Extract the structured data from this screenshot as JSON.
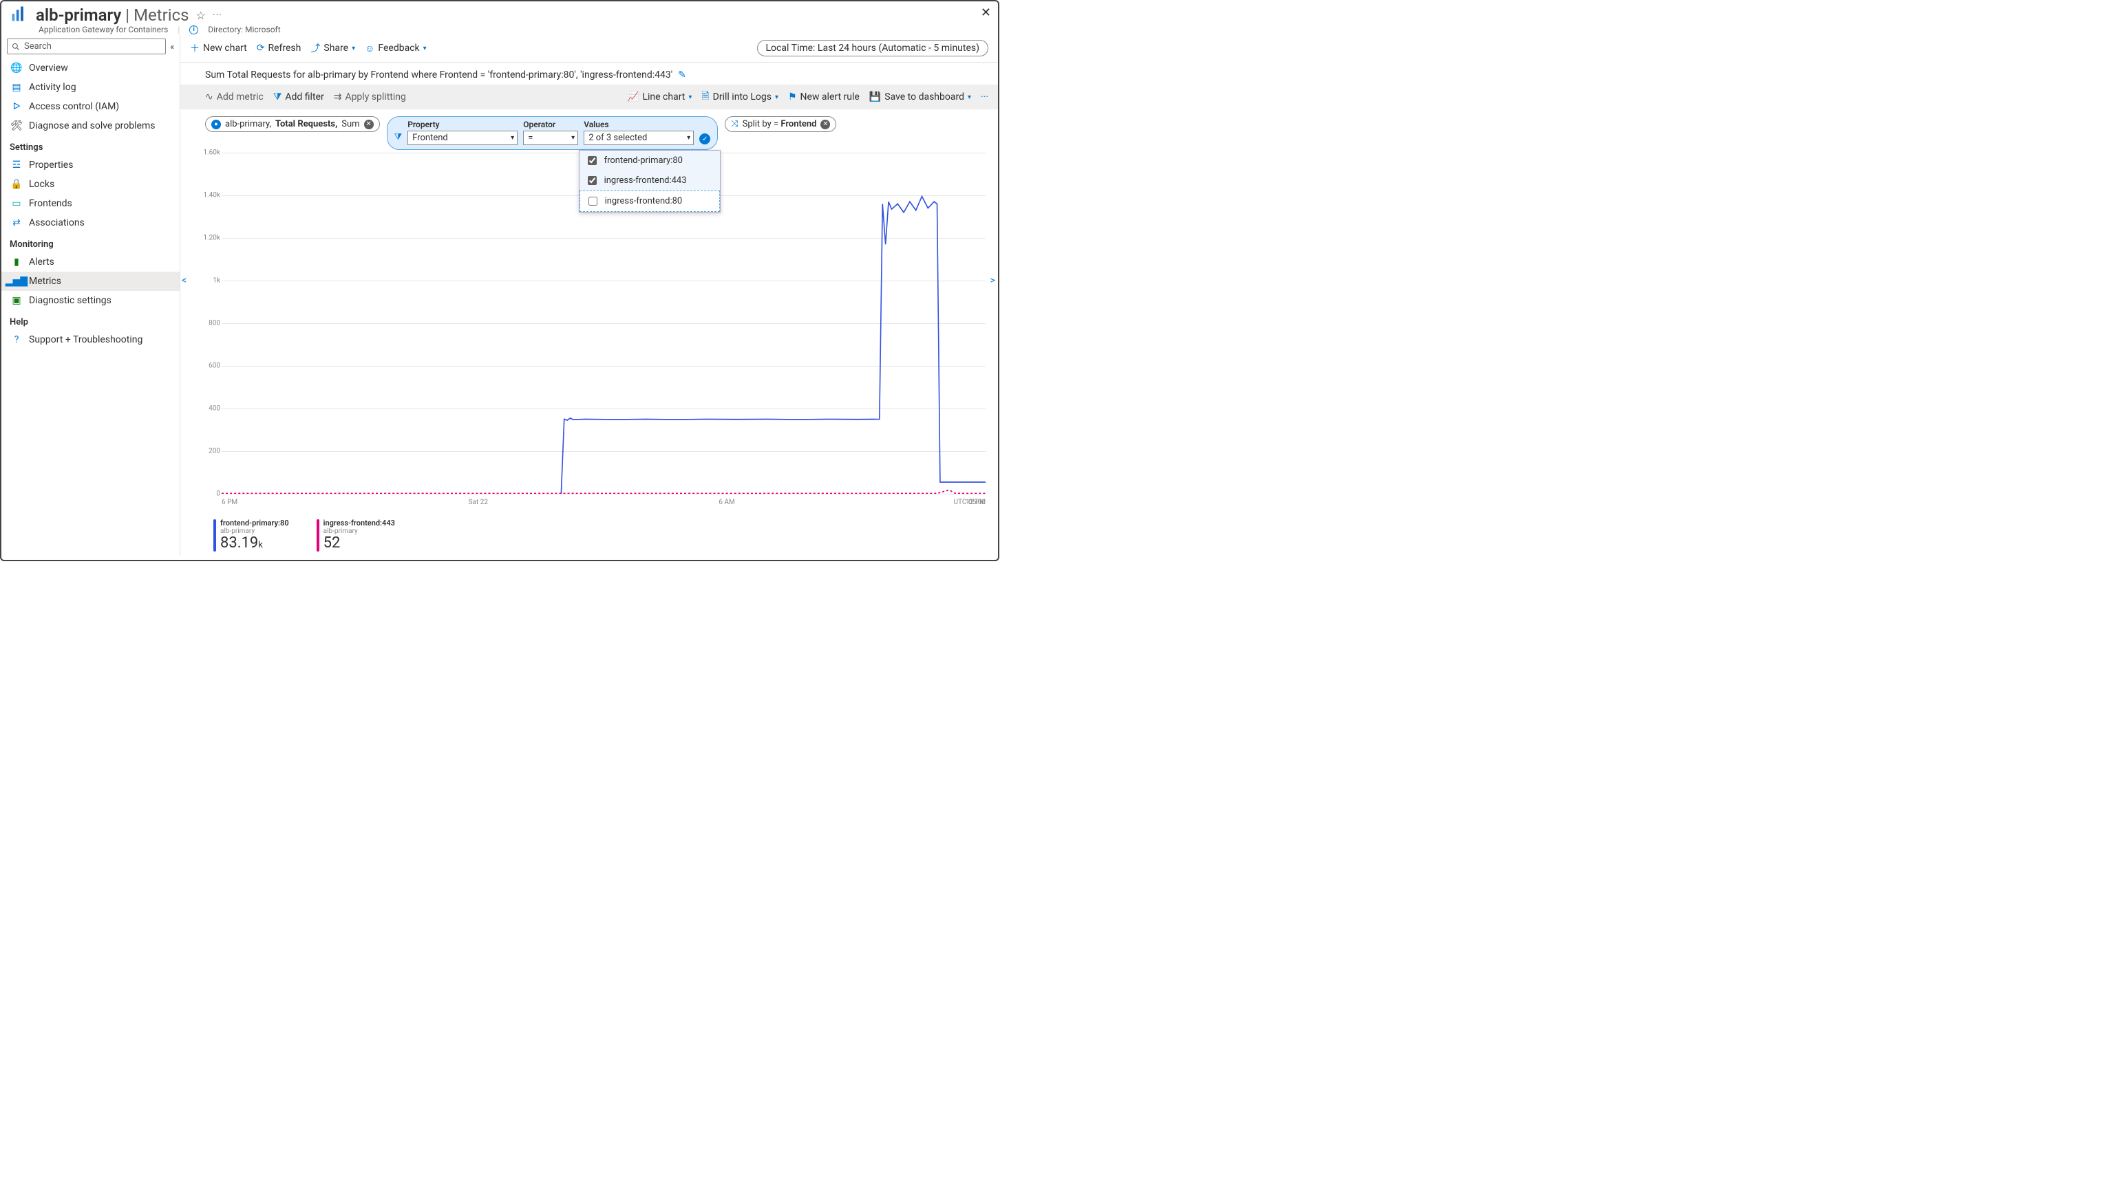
{
  "header": {
    "title_resource": "alb-primary",
    "title_page": "Metrics",
    "subtitle": "Application Gateway for Containers",
    "directory_label": "Directory: Microsoft"
  },
  "search_placeholder": "Search",
  "sidebar": {
    "items_top": [
      {
        "label": "Overview",
        "icon": "globe-icon"
      },
      {
        "label": "Activity log",
        "icon": "log-icon"
      },
      {
        "label": "Access control (IAM)",
        "icon": "people-icon"
      },
      {
        "label": "Diagnose and solve problems",
        "icon": "wrench-icon"
      }
    ],
    "section_settings": "Settings",
    "items_settings": [
      {
        "label": "Properties",
        "icon": "sliders-icon"
      },
      {
        "label": "Locks",
        "icon": "lock-icon"
      },
      {
        "label": "Frontends",
        "icon": "frontends-icon"
      },
      {
        "label": "Associations",
        "icon": "assoc-icon"
      }
    ],
    "section_monitoring": "Monitoring",
    "items_monitoring": [
      {
        "label": "Alerts",
        "icon": "alerts-icon"
      },
      {
        "label": "Metrics",
        "icon": "metrics-icon",
        "active": true
      },
      {
        "label": "Diagnostic settings",
        "icon": "diag-icon"
      }
    ],
    "section_help": "Help",
    "items_help": [
      {
        "label": "Support + Troubleshooting",
        "icon": "support-icon"
      }
    ]
  },
  "toolbar": {
    "new_chart": "New chart",
    "refresh": "Refresh",
    "share": "Share",
    "feedback": "Feedback",
    "time_range": "Local Time: Last 24 hours (Automatic - 5 minutes)"
  },
  "chart_header": "Sum Total Requests for alb-primary by Frontend where Frontend = 'frontend-primary:80', 'ingress-frontend:443'",
  "metricbar": {
    "add_metric": "Add metric",
    "add_filter": "Add filter",
    "apply_splitting": "Apply splitting",
    "line_chart": "Line chart",
    "drill_logs": "Drill into Logs",
    "new_alert": "New alert rule",
    "save_dash": "Save to dashboard"
  },
  "scope_pill": {
    "resource": "alb-primary,",
    "metric": "Total Requests,",
    "agg": "Sum"
  },
  "filter": {
    "property_label": "Property",
    "property_value": "Frontend",
    "operator_label": "Operator",
    "operator_value": "=",
    "values_label": "Values",
    "values_display": "2 of 3 selected",
    "options": [
      {
        "label": "frontend-primary:80",
        "checked": true
      },
      {
        "label": "ingress-frontend:443",
        "checked": true
      },
      {
        "label": "ingress-frontend:80",
        "checked": false
      }
    ]
  },
  "split_pill": {
    "prefix": "Split by = ",
    "value": "Frontend"
  },
  "utc_label": "UTC-05:00",
  "legend": [
    {
      "name": "frontend-primary:80",
      "sub": "alb-primary",
      "value": "83.19",
      "unit": "k",
      "color": "#3352e1"
    },
    {
      "name": "ingress-frontend:443",
      "sub": "alb-primary",
      "value": "52",
      "unit": "",
      "color": "#e3007b"
    }
  ],
  "chart_data": {
    "type": "line",
    "xlabel": "",
    "ylabel": "",
    "ylim": [
      0,
      1600
    ],
    "y_ticks": [
      "0",
      "200",
      "400",
      "600",
      "800",
      "1k",
      "1.20k",
      "1.40k",
      "1.60k"
    ],
    "x_ticks": [
      "6 PM",
      "Sat 22",
      "6 AM",
      "12 PM"
    ],
    "x_range_minutes": 1440,
    "series": [
      {
        "name": "frontend-primary:80",
        "color": "#3352e1",
        "points": [
          [
            560,
            0
          ],
          [
            565,
            350
          ],
          [
            570,
            345
          ],
          [
            575,
            355
          ],
          [
            580,
            348
          ],
          [
            600,
            350
          ],
          [
            650,
            348
          ],
          [
            700,
            350
          ],
          [
            750,
            348
          ],
          [
            800,
            350
          ],
          [
            850,
            349
          ],
          [
            900,
            350
          ],
          [
            950,
            348
          ],
          [
            1000,
            350
          ],
          [
            1050,
            349
          ],
          [
            1085,
            350
          ],
          [
            1090,
            1360
          ],
          [
            1095,
            1170
          ],
          [
            1100,
            1370
          ],
          [
            1105,
            1335
          ],
          [
            1115,
            1360
          ],
          [
            1125,
            1320
          ],
          [
            1135,
            1370
          ],
          [
            1145,
            1330
          ],
          [
            1155,
            1395
          ],
          [
            1165,
            1340
          ],
          [
            1175,
            1370
          ],
          [
            1180,
            1360
          ],
          [
            1185,
            55
          ],
          [
            1200,
            55
          ],
          [
            1230,
            55
          ],
          [
            1260,
            55
          ]
        ]
      },
      {
        "name": "ingress-frontend:443",
        "color": "#e3007b",
        "dashed": true,
        "points": [
          [
            0,
            2
          ],
          [
            100,
            2
          ],
          [
            200,
            2
          ],
          [
            300,
            2
          ],
          [
            400,
            2
          ],
          [
            500,
            2
          ],
          [
            600,
            2
          ],
          [
            700,
            2
          ],
          [
            800,
            2
          ],
          [
            900,
            2
          ],
          [
            1000,
            2
          ],
          [
            1100,
            2
          ],
          [
            1180,
            2
          ],
          [
            1200,
            18
          ],
          [
            1210,
            2
          ],
          [
            1260,
            2
          ]
        ]
      }
    ]
  }
}
